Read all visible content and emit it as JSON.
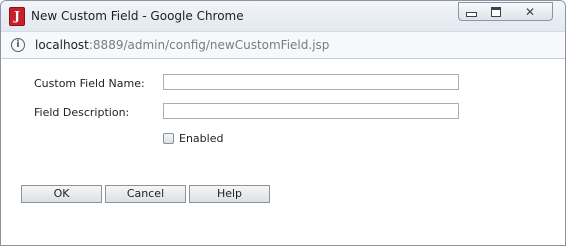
{
  "window": {
    "title": "New Custom Field - Google Chrome",
    "app_icon_letter": "J",
    "close_glyph": "✕"
  },
  "address": {
    "host": "localhost",
    "path": ":8889/admin/config/newCustomField.jsp",
    "info_glyph": "i"
  },
  "form": {
    "name_label": "Custom Field Name:",
    "name_value": "",
    "description_label": "Field Description:",
    "description_value": "",
    "enabled_label": "Enabled",
    "enabled_checked": false
  },
  "buttons": {
    "ok": "OK",
    "cancel": "Cancel",
    "help": "Help"
  },
  "icons": {
    "app": "app-j-icon",
    "info": "info-icon",
    "minimize": "minimize-icon",
    "maximize": "maximize-icon",
    "close": "close-icon"
  },
  "colors": {
    "app_icon": "#c8202b",
    "url_path": "#777d85"
  }
}
